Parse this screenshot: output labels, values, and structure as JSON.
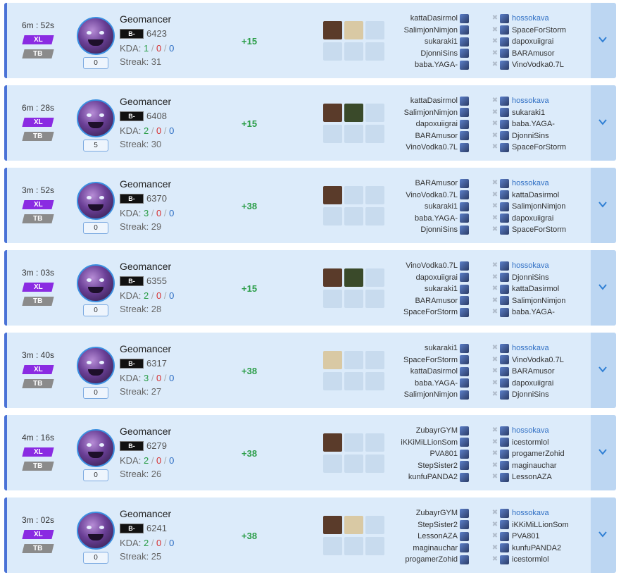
{
  "matches": [
    {
      "time": "6m : 52s",
      "mode": "XL",
      "map": "TB",
      "level": "0",
      "hero": "Geomancer",
      "rank": "B-",
      "mmr": "6423",
      "kda": {
        "label": "KDA:",
        "k": "1",
        "d": "0",
        "a": "0"
      },
      "streak": "Streak: 31",
      "delta": "+15",
      "items": [
        "filled",
        "light",
        "",
        "",
        "",
        ""
      ],
      "left": [
        "kattaDasirmol",
        "SalimjonNimjon",
        "sukaraki1",
        "DjonniSins",
        "baba.YAGA-"
      ],
      "right": [
        "hossokava",
        "SpaceForStorm",
        "dapoxuiigrai",
        "BARAmusor",
        "VinoVodka0.7L"
      ],
      "highlight_right": 0
    },
    {
      "time": "6m : 28s",
      "mode": "XL",
      "map": "TB",
      "level": "5",
      "hero": "Geomancer",
      "rank": "B-",
      "mmr": "6408",
      "kda": {
        "label": "KDA:",
        "k": "2",
        "d": "0",
        "a": "0"
      },
      "streak": "Streak: 30",
      "delta": "+15",
      "items": [
        "filled",
        "dark",
        "",
        "",
        "",
        ""
      ],
      "left": [
        "kattaDasirmol",
        "SalimjonNimjon",
        "dapoxuiigrai",
        "BARAmusor",
        "VinoVodka0.7L"
      ],
      "right": [
        "hossokava",
        "sukaraki1",
        "baba.YAGA-",
        "DjonniSins",
        "SpaceForStorm"
      ],
      "highlight_right": 0
    },
    {
      "time": "3m : 52s",
      "mode": "XL",
      "map": "TB",
      "level": "0",
      "hero": "Geomancer",
      "rank": "B-",
      "mmr": "6370",
      "kda": {
        "label": "KDA:",
        "k": "3",
        "d": "0",
        "a": "0"
      },
      "streak": "Streak: 29",
      "delta": "+38",
      "items": [
        "filled",
        "",
        "",
        "",
        "",
        ""
      ],
      "left": [
        "BARAmusor",
        "VinoVodka0.7L",
        "sukaraki1",
        "baba.YAGA-",
        "DjonniSins"
      ],
      "right": [
        "hossokava",
        "kattaDasirmol",
        "SalimjonNimjon",
        "dapoxuiigrai",
        "SpaceForStorm"
      ],
      "highlight_right": 0
    },
    {
      "time": "3m : 03s",
      "mode": "XL",
      "map": "TB",
      "level": "0",
      "hero": "Geomancer",
      "rank": "B-",
      "mmr": "6355",
      "kda": {
        "label": "KDA:",
        "k": "2",
        "d": "0",
        "a": "0"
      },
      "streak": "Streak: 28",
      "delta": "+15",
      "items": [
        "filled",
        "dark",
        "",
        "",
        "",
        ""
      ],
      "left": [
        "VinoVodka0.7L",
        "dapoxuiigrai",
        "sukaraki1",
        "BARAmusor",
        "SpaceForStorm"
      ],
      "right": [
        "hossokava",
        "DjonniSins",
        "kattaDasirmol",
        "SalimjonNimjon",
        "baba.YAGA-"
      ],
      "highlight_right": 0
    },
    {
      "time": "3m : 40s",
      "mode": "XL",
      "map": "TB",
      "level": "0",
      "hero": "Geomancer",
      "rank": "B-",
      "mmr": "6317",
      "kda": {
        "label": "KDA:",
        "k": "3",
        "d": "0",
        "a": "0"
      },
      "streak": "Streak: 27",
      "delta": "+38",
      "items": [
        "light",
        "",
        "",
        "",
        "",
        ""
      ],
      "left": [
        "sukaraki1",
        "SpaceForStorm",
        "kattaDasirmol",
        "baba.YAGA-",
        "SalimjonNimjon"
      ],
      "right": [
        "hossokava",
        "VinoVodka0.7L",
        "BARAmusor",
        "dapoxuiigrai",
        "DjonniSins"
      ],
      "highlight_right": 0
    },
    {
      "time": "4m : 16s",
      "mode": "XL",
      "map": "TB",
      "level": "0",
      "hero": "Geomancer",
      "rank": "B-",
      "mmr": "6279",
      "kda": {
        "label": "KDA:",
        "k": "2",
        "d": "0",
        "a": "0"
      },
      "streak": "Streak: 26",
      "delta": "+38",
      "items": [
        "filled",
        "",
        "",
        "",
        "",
        ""
      ],
      "left": [
        "ZubayrGYM",
        "iKKiMiLLionSom",
        "PVA801",
        "StepSister2",
        "kunfuPANDA2"
      ],
      "right": [
        "hossokava",
        "icestormlol",
        "progamerZohid",
        "maginauchar",
        "LessonAZA"
      ],
      "highlight_right": 0
    },
    {
      "time": "3m : 02s",
      "mode": "XL",
      "map": "TB",
      "level": "0",
      "hero": "Geomancer",
      "rank": "B-",
      "mmr": "6241",
      "kda": {
        "label": "KDA:",
        "k": "2",
        "d": "0",
        "a": "0"
      },
      "streak": "Streak: 25",
      "delta": "+38",
      "items": [
        "filled",
        "light",
        "",
        "",
        "",
        ""
      ],
      "left": [
        "ZubayrGYM",
        "StepSister2",
        "LessonAZA",
        "maginauchar",
        "progamerZohid"
      ],
      "right": [
        "hossokava",
        "iKKiMiLLionSom",
        "PVA801",
        "kunfuPANDA2",
        "icestormlol"
      ],
      "highlight_right": 0
    }
  ],
  "colors": {
    "card_bg": "#dcebfa",
    "accent": "#4a72d6",
    "mode_xl": "#8a2be2",
    "map_tb": "#8b8b8b",
    "positive": "#2a9d47",
    "deaths": "#d62d2d",
    "assists": "#2f6fc4",
    "expand_bg": "#bcd6f2"
  },
  "icons": {
    "vs": "crossed-swords-icon",
    "expand": "chevron-down-icon",
    "hero": "geomancer-portrait"
  }
}
